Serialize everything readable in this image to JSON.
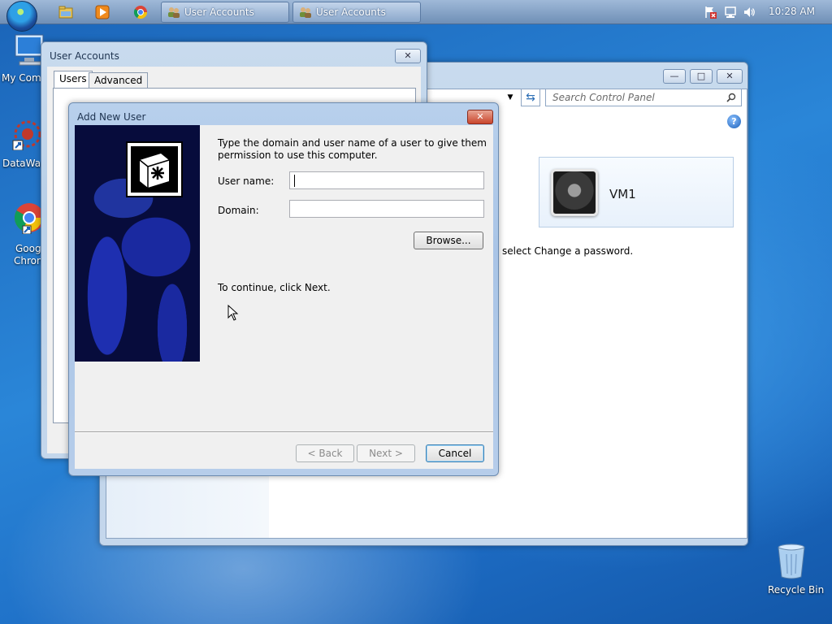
{
  "taskbar": {
    "buttons": [
      {
        "label": "User Accounts",
        "icon": "user-accounts-icon"
      },
      {
        "label": "User Accounts",
        "icon": "user-accounts-icon"
      }
    ],
    "quick_launch": [
      "explorer-icon",
      "media-player-icon",
      "chrome-icon"
    ],
    "tray_icons": [
      "action-center-icon",
      "network-icon",
      "volume-icon"
    ],
    "clock": "10:28 AM"
  },
  "desktop_icons": [
    {
      "label": "My Comp",
      "icon": "computer-icon"
    },
    {
      "label": "DataWag",
      "icon": "datawag-icon"
    },
    {
      "label": "Googl",
      "label2": "Chron",
      "icon": "chrome-icon"
    },
    {
      "label": "Recycle Bin",
      "icon": "recycle-bin-icon"
    }
  ],
  "control_panel": {
    "search_placeholder": "Search Control Panel",
    "account_name": "VM1",
    "hint_text": "select Change a password."
  },
  "user_accounts": {
    "title": "User Accounts",
    "tabs": [
      "Users",
      "Advanced"
    ]
  },
  "add_new_user": {
    "title": "Add New User",
    "intro_line1": "Type the domain and user name of a user to give them",
    "intro_line2": "permission to use this computer.",
    "username_label": "User name:",
    "username_value": "",
    "domain_label": "Domain:",
    "domain_value": "",
    "browse_label": "Browse...",
    "continue_text": "To continue, click Next.",
    "back_label": "< Back",
    "next_label": "Next >",
    "cancel_label": "Cancel"
  }
}
